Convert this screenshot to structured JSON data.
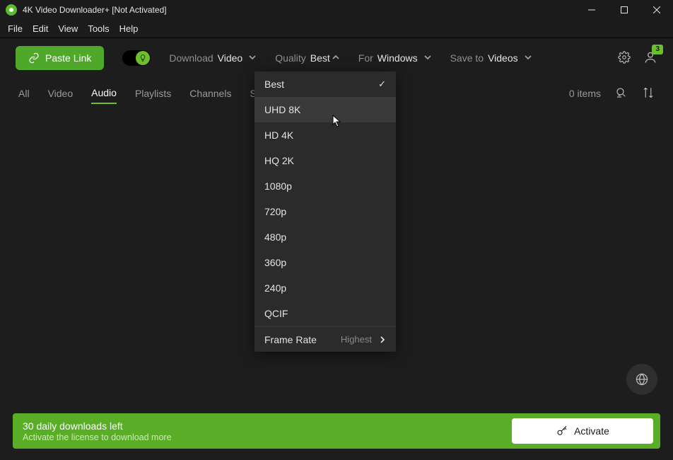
{
  "window": {
    "title": "4K Video Downloader+ [Not Activated]"
  },
  "menu": [
    "File",
    "Edit",
    "View",
    "Tools",
    "Help"
  ],
  "toolbar": {
    "paste_label": "Paste Link",
    "download_label": "Download",
    "download_value": "Video",
    "quality_label": "Quality",
    "quality_value": "Best",
    "for_label": "For",
    "for_value": "Windows",
    "saveto_label": "Save to",
    "saveto_value": "Videos",
    "badge": "3"
  },
  "tabs": {
    "items": [
      "All",
      "Video",
      "Audio",
      "Playlists",
      "Channels",
      "Subscriptions"
    ],
    "active_index": 2,
    "count_text": "0 items"
  },
  "quality_menu": {
    "options": [
      "Best",
      "UHD 8K",
      "HD 4K",
      "HQ 2K",
      "1080p",
      "720p",
      "480p",
      "360p",
      "240p",
      "QCIF"
    ],
    "checked_index": 0,
    "hover_index": 1,
    "framerate_label": "Frame Rate",
    "framerate_value": "Highest"
  },
  "banner": {
    "line1": "30 daily downloads left",
    "line2": "Activate the license to download more",
    "activate_label": "Activate"
  }
}
